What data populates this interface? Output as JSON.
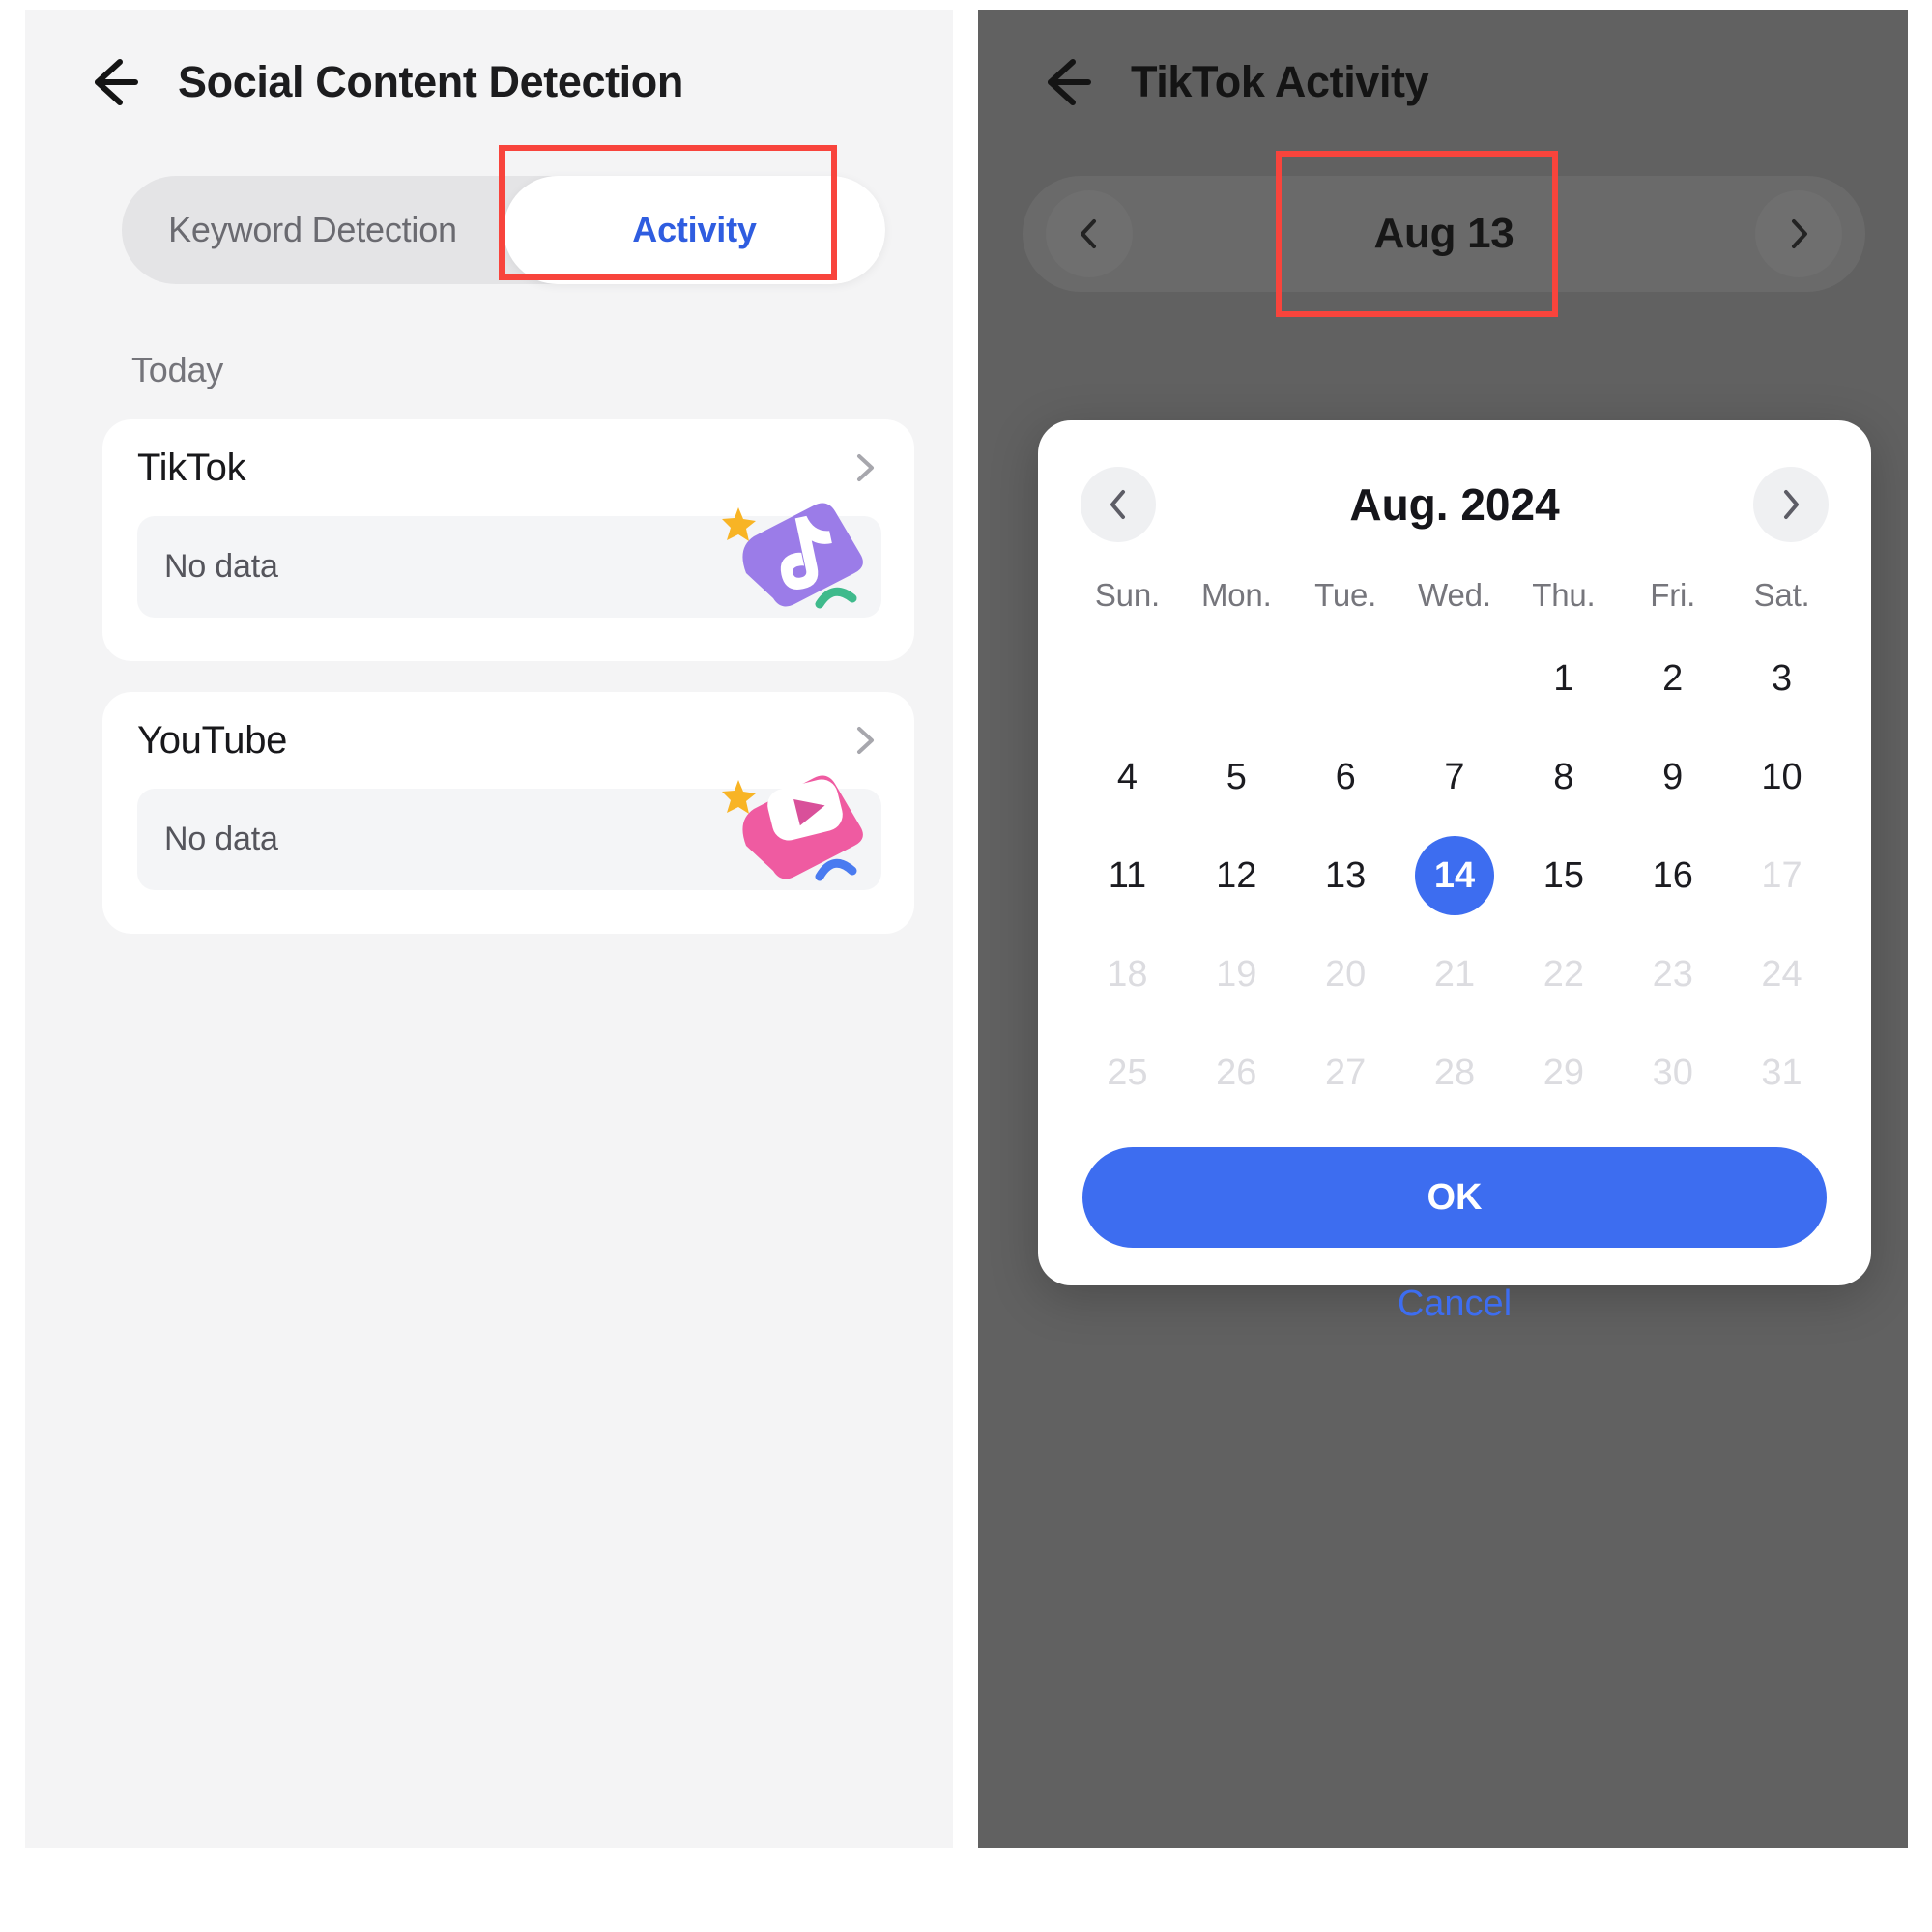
{
  "left_screen": {
    "back_icon": "back-arrow-icon",
    "title": "Social Content Detection",
    "tabs": [
      {
        "label": "Keyword Detection",
        "active": false
      },
      {
        "label": "Activity",
        "active": true
      }
    ],
    "section_label": "Today",
    "cards": [
      {
        "title": "TikTok",
        "status": "No data",
        "chevron_icon": "chevron-right-icon",
        "art_icon": "tiktok-logo-icon",
        "colors": {
          "tile": "#9b7ce8",
          "glyph": "#ffffff",
          "star": "#f8b425",
          "accent": "#3fba8c"
        }
      },
      {
        "title": "YouTube",
        "status": "No data",
        "chevron_icon": "chevron-right-icon",
        "art_icon": "youtube-logo-icon",
        "colors": {
          "tile": "#ef5ba1",
          "glyph": "#ffffff",
          "star": "#f8b425",
          "accent": "#4a7bf0"
        }
      }
    ]
  },
  "right_screen": {
    "back_icon": "back-arrow-icon",
    "title": "TikTok Activity",
    "date_nav": {
      "prev_icon": "chevron-left-icon",
      "current_date": "Aug 13",
      "next_icon": "chevron-right-icon"
    },
    "dialog": {
      "prev_month_icon": "chevron-left-icon",
      "month_year": "Aug. 2024",
      "next_month_icon": "chevron-right-icon",
      "weekdays": [
        "Sun.",
        "Mon.",
        "Tue.",
        "Wed.",
        "Thu.",
        "Fri.",
        "Sat."
      ],
      "weeks": [
        [
          {
            "d": "",
            "state": "empty"
          },
          {
            "d": "",
            "state": "empty"
          },
          {
            "d": "",
            "state": "empty"
          },
          {
            "d": "",
            "state": "empty"
          },
          {
            "d": "1",
            "state": "normal"
          },
          {
            "d": "2",
            "state": "normal"
          },
          {
            "d": "3",
            "state": "normal"
          }
        ],
        [
          {
            "d": "4",
            "state": "normal"
          },
          {
            "d": "5",
            "state": "normal"
          },
          {
            "d": "6",
            "state": "normal"
          },
          {
            "d": "7",
            "state": "normal"
          },
          {
            "d": "8",
            "state": "normal"
          },
          {
            "d": "9",
            "state": "normal"
          },
          {
            "d": "10",
            "state": "normal"
          }
        ],
        [
          {
            "d": "11",
            "state": "normal"
          },
          {
            "d": "12",
            "state": "normal"
          },
          {
            "d": "13",
            "state": "normal"
          },
          {
            "d": "14",
            "state": "selected"
          },
          {
            "d": "15",
            "state": "normal"
          },
          {
            "d": "16",
            "state": "normal"
          },
          {
            "d": "17",
            "state": "muted"
          }
        ],
        [
          {
            "d": "18",
            "state": "muted"
          },
          {
            "d": "19",
            "state": "muted"
          },
          {
            "d": "20",
            "state": "muted"
          },
          {
            "d": "21",
            "state": "muted"
          },
          {
            "d": "22",
            "state": "muted"
          },
          {
            "d": "23",
            "state": "muted"
          },
          {
            "d": "24",
            "state": "muted"
          }
        ],
        [
          {
            "d": "25",
            "state": "muted"
          },
          {
            "d": "26",
            "state": "muted"
          },
          {
            "d": "27",
            "state": "muted"
          },
          {
            "d": "28",
            "state": "muted"
          },
          {
            "d": "29",
            "state": "muted"
          },
          {
            "d": "30",
            "state": "muted"
          },
          {
            "d": "31",
            "state": "muted"
          }
        ]
      ],
      "ok_label": "OK",
      "cancel_label": "Cancel"
    }
  },
  "annotations": {
    "highlight_color": "#f8443c",
    "boxes": [
      "activity-tab",
      "date-label"
    ]
  },
  "theme": {
    "accent_blue": "#3d6df0",
    "tab_active_blue": "#2f5de0",
    "left_bg": "#f4f4f5",
    "right_bg": "#616161",
    "card_bg": "#ffffff"
  }
}
